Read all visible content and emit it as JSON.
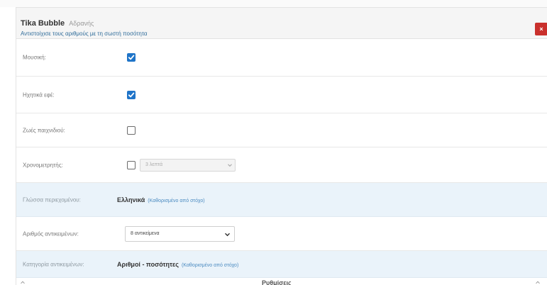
{
  "header": {
    "title": "Tika Bubble",
    "title_sub": "Αδρανής",
    "subtitle": "Αντιστοίχισε τους αριθμούς με τη σωστή ποσότητα",
    "close_label": "×"
  },
  "settings": {
    "music_label": "Μουσική:",
    "music_checked": true,
    "sfx_label": "Ηχητικά εφέ:",
    "sfx_checked": true,
    "lives_label": "Ζωές παιχνιδιού:",
    "lives_checked": false,
    "timer_label": "Χρονομετρητής:",
    "timer_checked": false,
    "timer_value": "3 λεπτά",
    "language_label": "Γλώσσα περιεχομένου:",
    "language_value": "Ελληνικά",
    "language_note": "(Καθορισμένο από στόχο)",
    "count_label": "Αριθμός αντικειμένων:",
    "count_value": "8 αντικείμενα",
    "category_label": "Κατηγορία αντικειμένων:",
    "category_value": "Αριθμοί - ποσότητες",
    "category_note": "(Καθορισμένο από στόχο)"
  },
  "footer": {
    "title": "Ρυθμίσεις"
  },
  "colors": {
    "accent": "#1f74c8",
    "close": "#c9302c",
    "info_row": "#eaf3fa",
    "note": "#4a8ac0"
  }
}
